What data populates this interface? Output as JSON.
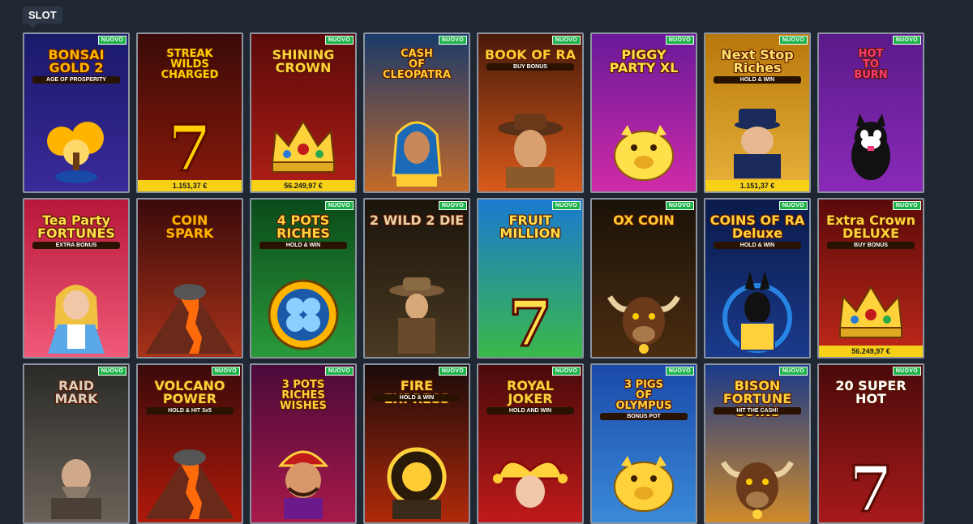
{
  "section": {
    "label": "SLOT"
  },
  "badge_label": "NUOVO",
  "games": [
    {
      "title": "BONSAI\nGOLD 2",
      "subtitle": "AGE OF PROSPERITY",
      "new": true,
      "jackpot": "",
      "bg": [
        "#1a1a6a",
        "#3a2a9a"
      ],
      "emblem": "tree-icon",
      "accent": "#ffb400"
    },
    {
      "title": "STREAK\nWILDS\nCHARGED",
      "subtitle": "",
      "new": false,
      "jackpot": "1.151,37 €",
      "bg": [
        "#3a0a08",
        "#8a1a0a"
      ],
      "emblem": "sevens-icon",
      "accent": "#ffcf00"
    },
    {
      "title": "SHINING\nCROWN",
      "subtitle": "",
      "new": true,
      "jackpot": "56.249,97 €",
      "bg": [
        "#5a0a0a",
        "#b01e16"
      ],
      "emblem": "crown-icon",
      "accent": "#ffd23c"
    },
    {
      "title": "CASH\nOF\nCLEOPATRA",
      "subtitle": "",
      "new": true,
      "jackpot": "",
      "bg": [
        "#1a3a6a",
        "#c46a2a"
      ],
      "emblem": "pharaoh-icon",
      "accent": "#ffcc33"
    },
    {
      "title": "BOOK OF RA",
      "subtitle": "BUY BONUS",
      "new": true,
      "jackpot": "",
      "bg": [
        "#4a1a0a",
        "#d85a1a"
      ],
      "emblem": "explorer-icon",
      "accent": "#ffcc33"
    },
    {
      "title": "PIGGY\nPARTY XL",
      "subtitle": "",
      "new": true,
      "jackpot": "",
      "bg": [
        "#6a1a9a",
        "#d02aa8"
      ],
      "emblem": "piggy-icon",
      "accent": "#ffe04a"
    },
    {
      "title": "Next Stop\nRiches",
      "subtitle": "HOLD & WIN",
      "new": true,
      "jackpot": "1.151,37 €",
      "bg": [
        "#b8780a",
        "#e8b23a"
      ],
      "emblem": "conductor-icon",
      "accent": "#ffe36b"
    },
    {
      "title": "HOT\nTO\nBURN",
      "subtitle": "",
      "new": true,
      "jackpot": "",
      "bg": [
        "#5a1a8a",
        "#8a2ab8"
      ],
      "emblem": "cat-icon",
      "accent": "#ff3a7a"
    },
    {
      "title": "Tea Party\nFORTUNES",
      "subtitle": "EXTRA BONUS",
      "new": false,
      "jackpot": "",
      "bg": [
        "#b8183a",
        "#f05a78"
      ],
      "emblem": "alice-icon",
      "accent": "#ffe04a"
    },
    {
      "title": "COIN\nSPARK",
      "subtitle": "",
      "new": false,
      "jackpot": "",
      "bg": [
        "#3a0a0a",
        "#a8321a"
      ],
      "emblem": "volcano-icon",
      "accent": "#ffb400"
    },
    {
      "title": "4 POTS\nRICHES",
      "subtitle": "HOLD & WIN",
      "new": true,
      "jackpot": "",
      "bg": [
        "#0a4a1a",
        "#2a9a3a"
      ],
      "emblem": "clover-coin-icon",
      "accent": "#ffd23c"
    },
    {
      "title": "2 WILD 2 DIE",
      "subtitle": "",
      "new": true,
      "jackpot": "",
      "bg": [
        "#1a140c",
        "#4a3a22"
      ],
      "emblem": "cowgirl-icon",
      "accent": "#e8d4a8"
    },
    {
      "title": "FRUIT MILLION",
      "subtitle": "",
      "new": true,
      "jackpot": "",
      "bg": [
        "#1a7acf",
        "#3ab84a"
      ],
      "emblem": "seven-icon",
      "accent": "#ffe04a"
    },
    {
      "title": "OX COIN",
      "subtitle": "",
      "new": true,
      "jackpot": "",
      "bg": [
        "#1a1208",
        "#4a2c10"
      ],
      "emblem": "ox-icon",
      "accent": "#ffcc33"
    },
    {
      "title": "COINS OF RA\nDeluxe",
      "subtitle": "HOLD & WIN",
      "new": true,
      "jackpot": "",
      "bg": [
        "#0a1a4a",
        "#1a3a8a"
      ],
      "emblem": "anubis-icon",
      "accent": "#ffd23c"
    },
    {
      "title": "Extra Crown\nDELUXE",
      "subtitle": "BUY BONUS",
      "new": true,
      "jackpot": "56.249,97 €",
      "bg": [
        "#5a0a0a",
        "#c0281a"
      ],
      "emblem": "crown-icon",
      "accent": "#ffd23c"
    },
    {
      "title": "RAID\nMARK",
      "subtitle": "",
      "new": true,
      "jackpot": "",
      "bg": [
        "#2a2a28",
        "#6a6258"
      ],
      "emblem": "viking-icon",
      "accent": "#d8d0c0"
    },
    {
      "title": "VOLCANO\nPOWER",
      "subtitle": "HOLD & HIT 3x5",
      "new": true,
      "jackpot": "",
      "bg": [
        "#3a0a0a",
        "#b01a0a"
      ],
      "emblem": "volcano-icon",
      "accent": "#ffd23c"
    },
    {
      "title": "3 POTS\nRICHES\nWISHES",
      "subtitle": "",
      "new": true,
      "jackpot": "",
      "bg": [
        "#4a0a3a",
        "#a81a4a"
      ],
      "emblem": "genie-icon",
      "accent": "#ffd23c"
    },
    {
      "title": "FIRE EXPRESS",
      "subtitle": "HOLD & WIN",
      "new": true,
      "jackpot": "",
      "bg": [
        "#1a0a0a",
        "#b02a0a"
      ],
      "emblem": "train-icon",
      "accent": "#ffd23c"
    },
    {
      "title": "ROYAL\nJOKER",
      "subtitle": "HOLD AND WIN",
      "new": true,
      "jackpot": "",
      "bg": [
        "#4a0a0a",
        "#c01a1a"
      ],
      "emblem": "jester-icon",
      "accent": "#ffd23c"
    },
    {
      "title": "3 PIGS\nOF\nOLYMPUS",
      "subtitle": "BONUS POT",
      "new": true,
      "jackpot": "",
      "bg": [
        "#1a4aaa",
        "#3a8ad8"
      ],
      "emblem": "pig-icon",
      "accent": "#ffd23c"
    },
    {
      "title": "BISON\nFORTUNE COINS",
      "subtitle": "HIT THE CASH!",
      "new": true,
      "jackpot": "",
      "bg": [
        "#1a3a8a",
        "#d08a2a"
      ],
      "emblem": "bison-icon",
      "accent": "#ffd23c"
    },
    {
      "title": "20 SUPER HOT",
      "subtitle": "",
      "new": true,
      "jackpot": "",
      "bg": [
        "#4a0a0a",
        "#a81a1a"
      ],
      "emblem": "seven-icon",
      "accent": "#ffffff"
    }
  ]
}
